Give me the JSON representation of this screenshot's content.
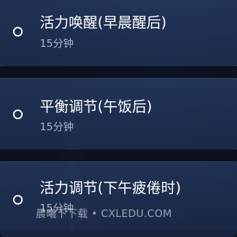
{
  "items": [
    {
      "title": "活力唤醒(早晨醒后)",
      "duration": "15分钟"
    },
    {
      "title": "平衡调节(午饭后)",
      "duration": "15分钟"
    },
    {
      "title": "活力调节(下午疲倦时)",
      "duration": "15分钟"
    }
  ],
  "watermark": "晨曦下下载 • CXLEDU.COM",
  "colors": {
    "card": "#213356",
    "text": "#ffffff",
    "subtext": "#d2dceb"
  }
}
